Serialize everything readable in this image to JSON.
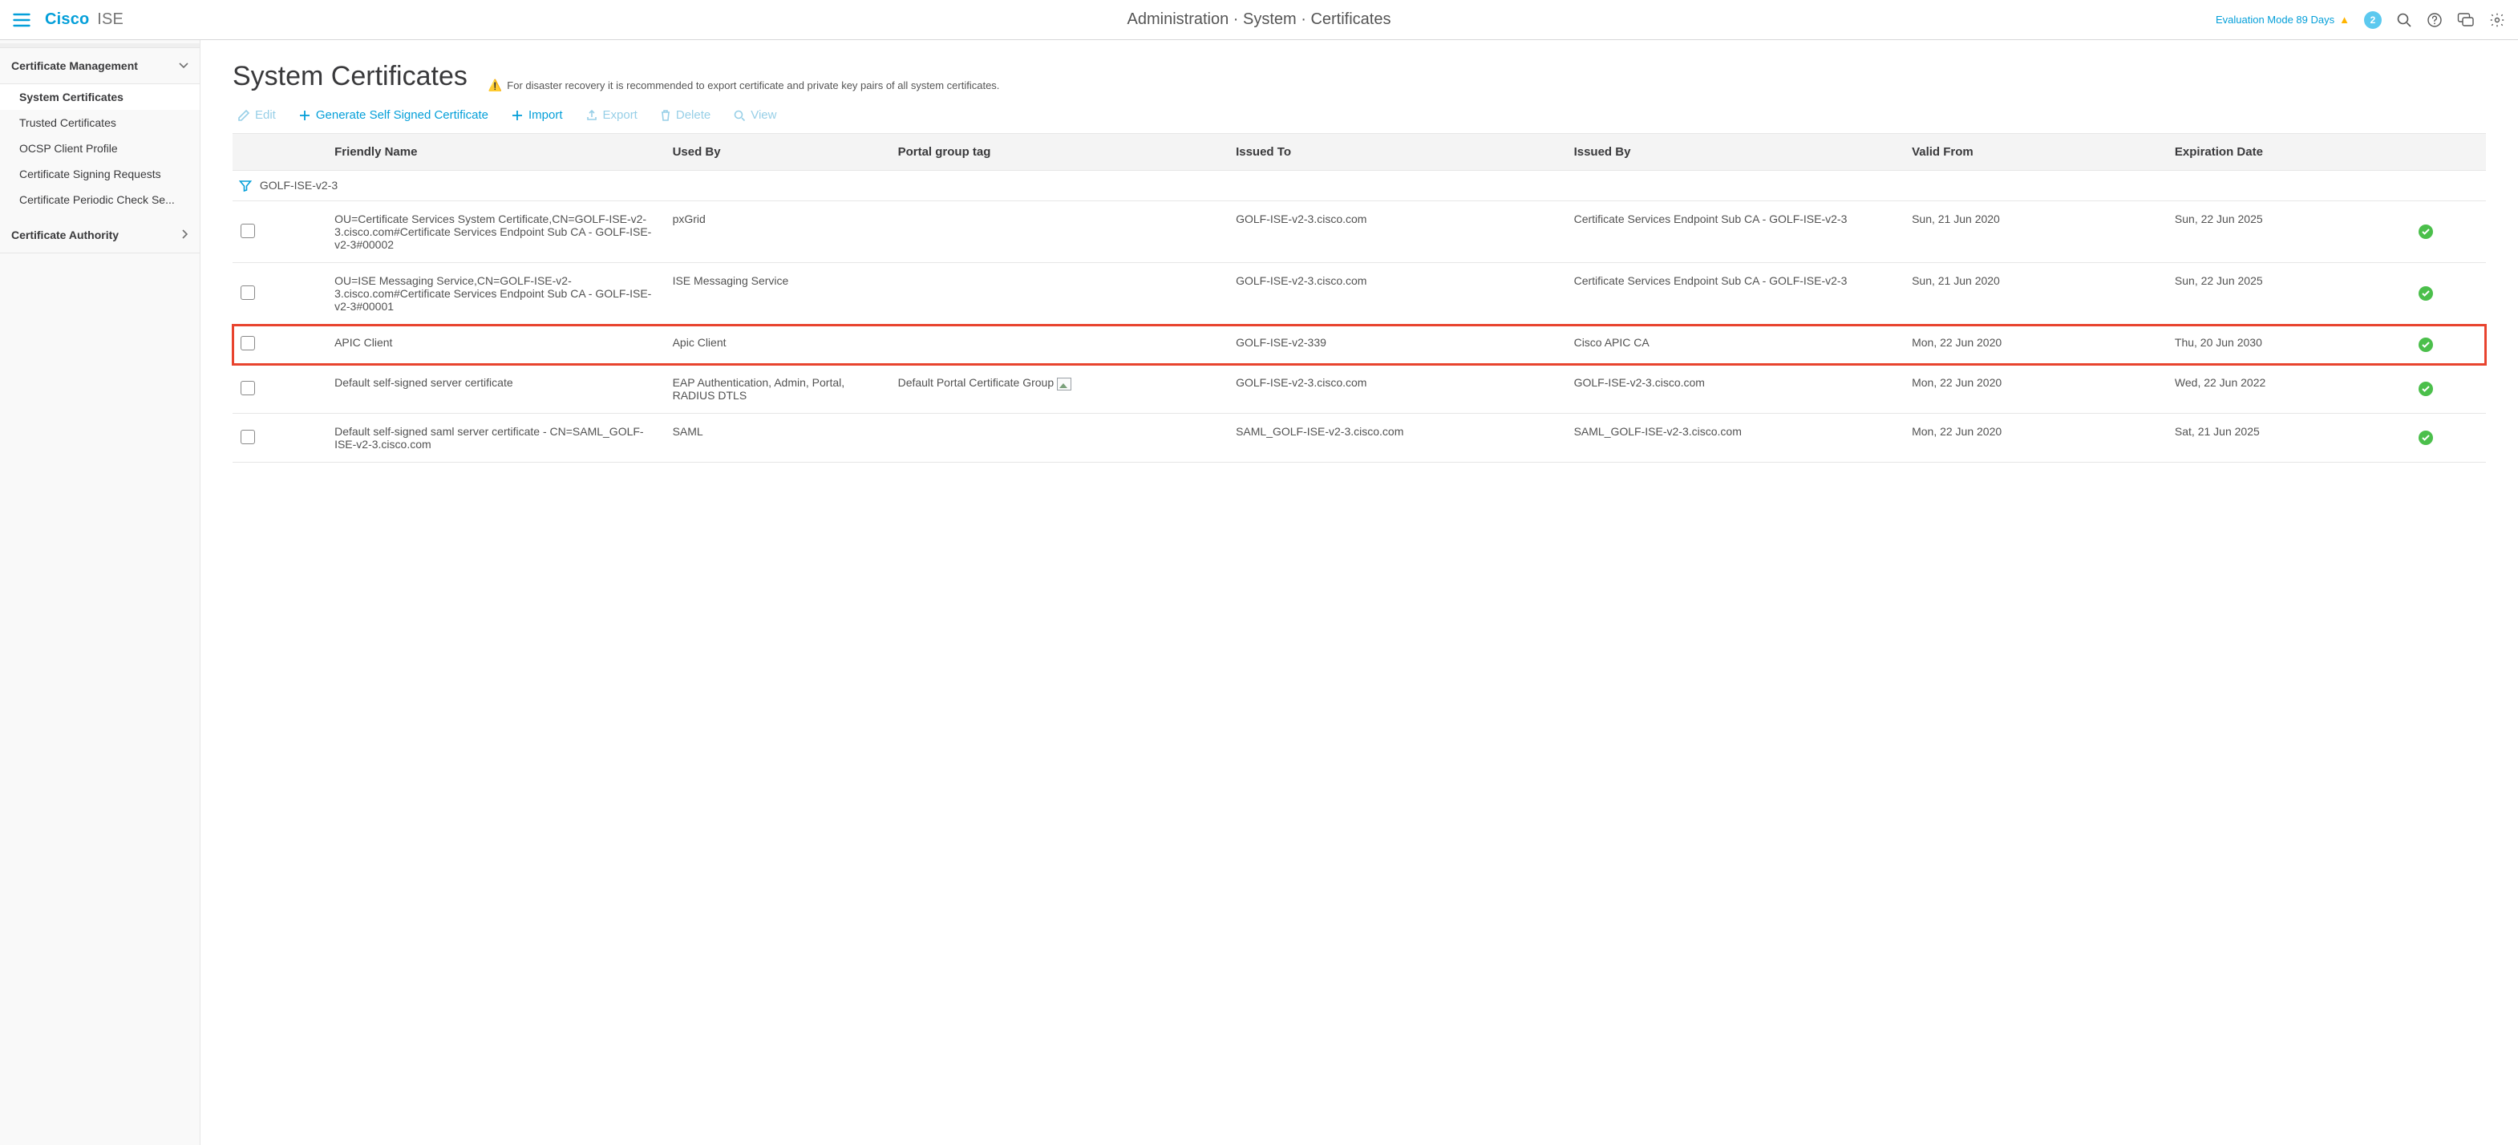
{
  "brand": {
    "name": "Cisco",
    "product": "ISE"
  },
  "breadcrumb": "Administration · System · Certificates",
  "header_right": {
    "eval_text": "Evaluation Mode 89 Days",
    "notif_count": "2"
  },
  "sidebar": {
    "group1": {
      "title": "Certificate Management",
      "items": [
        {
          "label": "System Certificates",
          "active": true
        },
        {
          "label": "Trusted Certificates"
        },
        {
          "label": "OCSP Client Profile"
        },
        {
          "label": "Certificate Signing Requests"
        },
        {
          "label": "Certificate Periodic Check Se..."
        }
      ]
    },
    "group2": {
      "title": "Certificate Authority"
    }
  },
  "page": {
    "title": "System Certificates",
    "hint": "For disaster recovery it is recommended to export certificate and private key pairs of all system certificates."
  },
  "toolbar": {
    "edit": "Edit",
    "generate": "Generate Self Signed Certificate",
    "import": "Import",
    "export": "Export",
    "delete": "Delete",
    "view": "View"
  },
  "table": {
    "headers": {
      "friendly": "Friendly Name",
      "usedby": "Used By",
      "portaltag": "Portal group tag",
      "issuedto": "Issued To",
      "issuedby": "Issued By",
      "validfrom": "Valid From",
      "expdate": "Expiration Date"
    },
    "filter_label": "GOLF-ISE-v2-3",
    "rows": [
      {
        "friendly": "OU=Certificate Services System Certificate,CN=GOLF-ISE-v2-3.cisco.com#Certificate Services Endpoint Sub CA - GOLF-ISE-v2-3#00002",
        "usedby": "pxGrid",
        "portaltag": "",
        "issuedto": "GOLF-ISE-v2-3.cisco.com",
        "issuedby": "Certificate Services Endpoint Sub CA - GOLF-ISE-v2-3",
        "validfrom": "Sun, 21 Jun 2020",
        "expdate": "Sun, 22 Jun 2025",
        "highlight": false
      },
      {
        "friendly": "OU=ISE Messaging Service,CN=GOLF-ISE-v2-3.cisco.com#Certificate Services Endpoint Sub CA - GOLF-ISE-v2-3#00001",
        "usedby": "ISE Messaging Service",
        "portaltag": "",
        "issuedto": "GOLF-ISE-v2-3.cisco.com",
        "issuedby": "Certificate Services Endpoint Sub CA - GOLF-ISE-v2-3",
        "validfrom": "Sun, 21 Jun 2020",
        "expdate": "Sun, 22 Jun 2025",
        "highlight": false
      },
      {
        "friendly": "APIC Client",
        "usedby": "Apic Client",
        "portaltag": "",
        "issuedto": "GOLF-ISE-v2-339",
        "issuedby": "Cisco APIC CA",
        "validfrom": "Mon, 22 Jun 2020",
        "expdate": "Thu, 20 Jun 2030",
        "highlight": true
      },
      {
        "friendly": "Default self-signed server certificate",
        "usedby": "EAP Authentication, Admin, Portal, RADIUS DTLS",
        "portaltag": "Default Portal Certificate Group",
        "portaltag_img": true,
        "issuedto": "GOLF-ISE-v2-3.cisco.com",
        "issuedby": "GOLF-ISE-v2-3.cisco.com",
        "validfrom": "Mon, 22 Jun 2020",
        "expdate": "Wed, 22 Jun 2022",
        "highlight": false
      },
      {
        "friendly": "Default self-signed saml server certificate - CN=SAML_GOLF-ISE-v2-3.cisco.com",
        "usedby": "SAML",
        "portaltag": "",
        "issuedto": "SAML_GOLF-ISE-v2-3.cisco.com",
        "issuedby": "SAML_GOLF-ISE-v2-3.cisco.com",
        "validfrom": "Mon, 22 Jun 2020",
        "expdate": "Sat, 21 Jun 2025",
        "highlight": false
      }
    ]
  }
}
